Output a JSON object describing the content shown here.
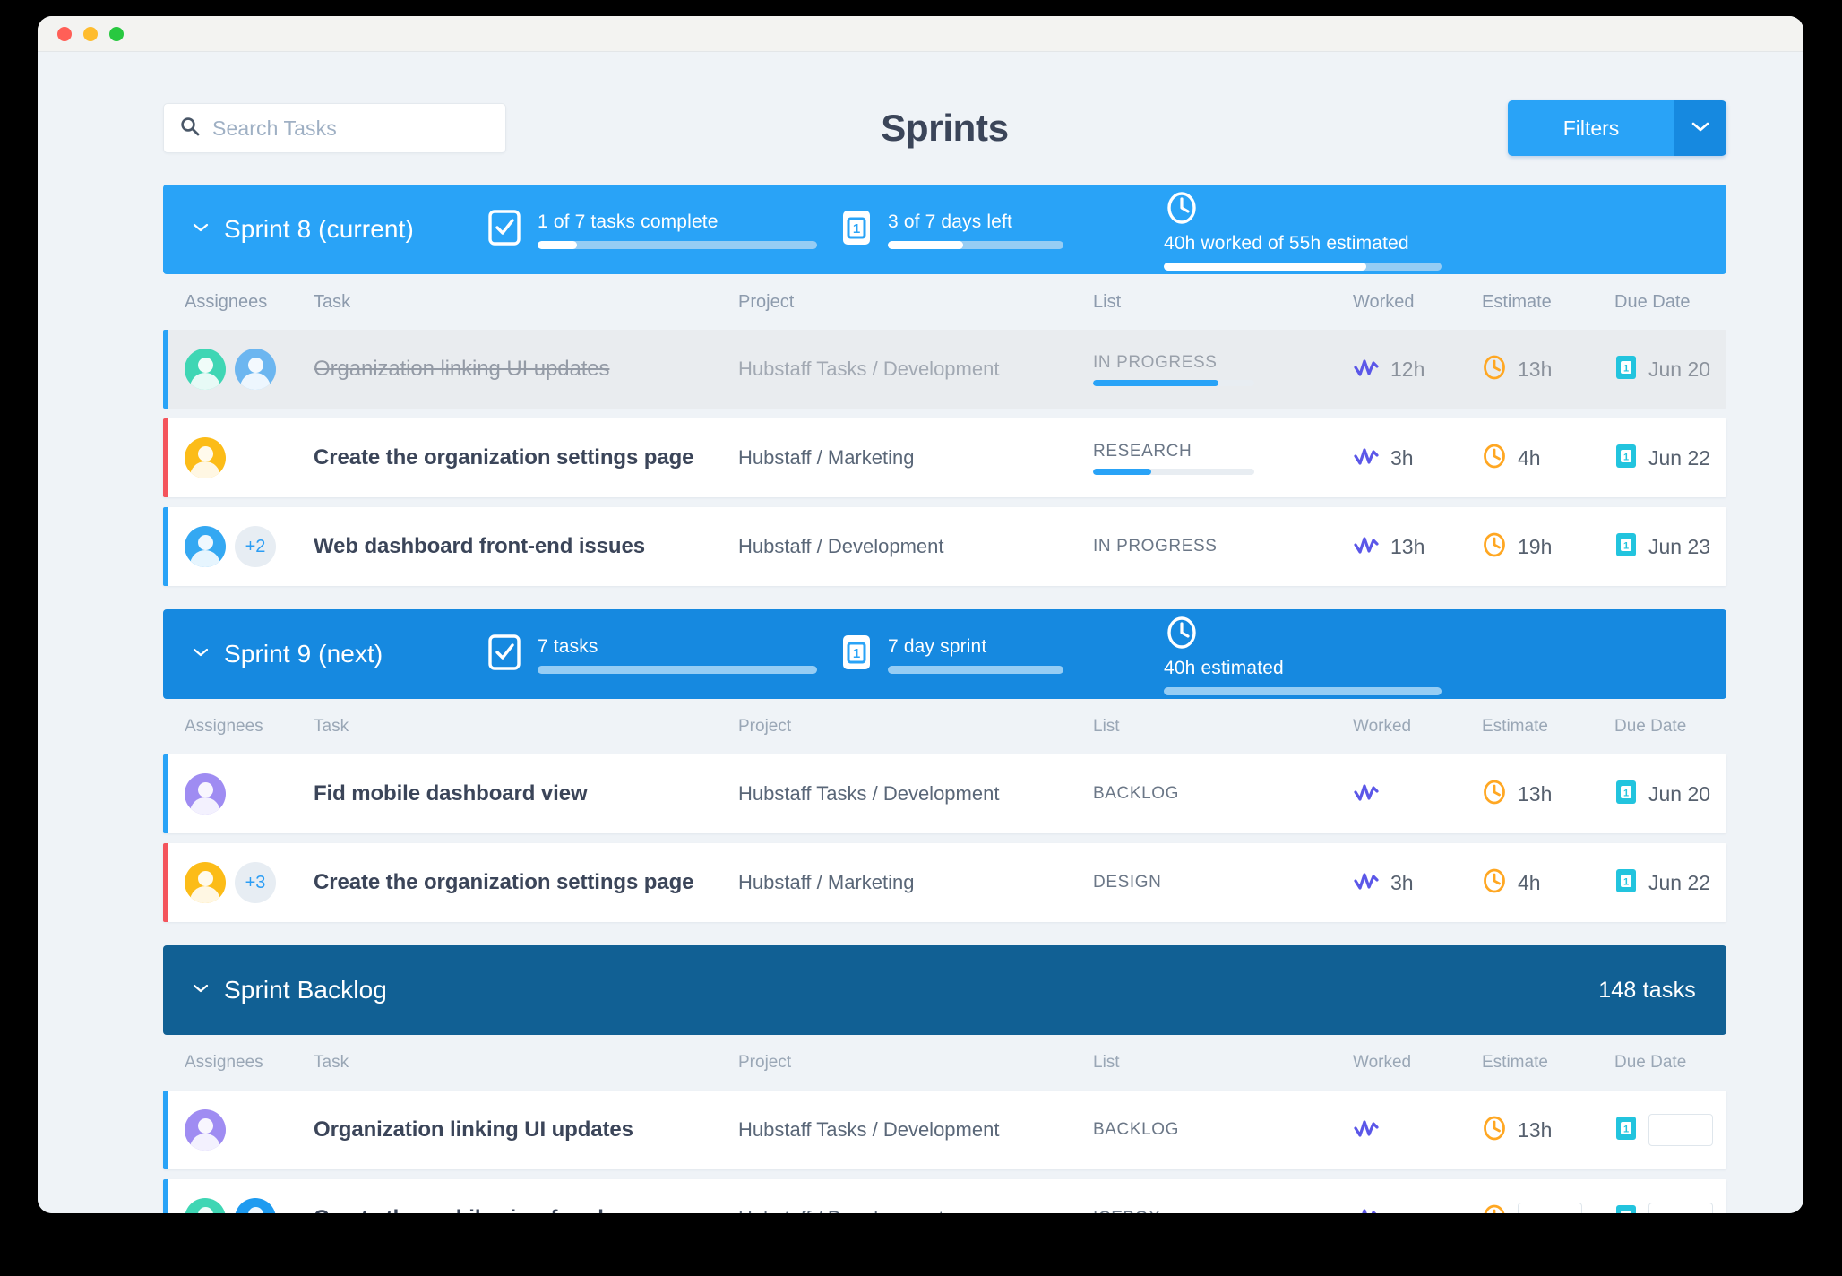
{
  "window": {
    "traffic_lights": [
      "close",
      "minimize",
      "maximize"
    ]
  },
  "header": {
    "title": "Sprints",
    "search": {
      "placeholder": "Search Tasks",
      "value": "",
      "icon": "search-icon"
    },
    "filters": {
      "label": "Filters",
      "caret_icon": "chevron-down-icon"
    }
  },
  "colors": {
    "accent_blue": "#29a3f7",
    "accent_blue_dark": "#1689e0",
    "backlog_blue": "#116094",
    "accent_red": "#f4545c",
    "worked_purple": "#5b57e8",
    "estimate_orange": "#ffa722",
    "due_cyan": "#22c4de",
    "text_dark": "#3b4559",
    "text_muted": "#8d9bad"
  },
  "columns": [
    "Assignees",
    "Task",
    "Project",
    "List",
    "Worked",
    "Estimate",
    "Due Date"
  ],
  "sections": [
    {
      "id": "sprint-8",
      "title": "Sprint 8 (current)",
      "style": "current",
      "collapse_icon": "chevron-down-icon",
      "stats": [
        {
          "icon": "checkbox-icon",
          "text": "1 of 7 tasks complete",
          "progress_pct": 14
        },
        {
          "icon": "calendar-icon",
          "text": "3 of 7 days left",
          "progress_pct": 43
        },
        {
          "icon": "clock-icon",
          "text": "40h worked of 55h estimated",
          "progress_pct": 73
        }
      ],
      "rows": [
        {
          "avatars": [
            "teal",
            "blue"
          ],
          "extra": "",
          "task": "Organization linking UI updates",
          "project": "Hubstaff Tasks / Development",
          "list": "IN PROGRESS",
          "list_progress_pct": 78,
          "worked": "12h",
          "estimate": "13h",
          "due": "Jun 20",
          "accent": "blue",
          "done": true
        },
        {
          "avatars": [
            "gold"
          ],
          "extra": "",
          "task": "Create the organization settings page",
          "project": "Hubstaff / Marketing",
          "list": "RESEARCH",
          "list_progress_pct": 36,
          "worked": "3h",
          "estimate": "4h",
          "due": "Jun 22",
          "accent": "red",
          "done": false
        },
        {
          "avatars": [
            "sky"
          ],
          "extra": "+2",
          "task": "Web dashboard front-end issues",
          "project": "Hubstaff / Development",
          "list": "IN PROGRESS",
          "list_progress_pct": null,
          "worked": "13h",
          "estimate": "19h",
          "due": "Jun 23",
          "accent": "blue",
          "done": false
        }
      ]
    },
    {
      "id": "sprint-9",
      "title": "Sprint 9 (next)",
      "style": "next",
      "collapse_icon": "chevron-down-icon",
      "stats": [
        {
          "icon": "checkbox-icon",
          "text": "7 tasks",
          "progress_pct": 0
        },
        {
          "icon": "calendar-icon",
          "text": "7 day sprint",
          "progress_pct": 0
        },
        {
          "icon": "clock-icon",
          "text": "40h estimated",
          "progress_pct": 0
        }
      ],
      "rows": [
        {
          "avatars": [
            "violet"
          ],
          "extra": "",
          "task": "Fid mobile dashboard view",
          "project": "Hubstaff Tasks / Development",
          "list": "BACKLOG",
          "list_progress_pct": null,
          "worked": "",
          "estimate": "13h",
          "due": "Jun 20",
          "accent": "blue",
          "done": false
        },
        {
          "avatars": [
            "gold"
          ],
          "extra": "+3",
          "task": "Create the organization settings page",
          "project": "Hubstaff / Marketing",
          "list": "DESIGN",
          "list_progress_pct": null,
          "worked": "3h",
          "estimate": "4h",
          "due": "Jun 22",
          "accent": "red",
          "done": false
        }
      ]
    },
    {
      "id": "sprint-backlog",
      "title": "Sprint Backlog",
      "style": "backlog",
      "collapse_icon": "chevron-down-icon",
      "count_label": "148 tasks",
      "stats": [],
      "rows": [
        {
          "avatars": [
            "violet"
          ],
          "extra": "",
          "task": "Organization linking UI updates",
          "project": "Hubstaff Tasks / Development",
          "list": "BACKLOG",
          "list_progress_pct": null,
          "worked": "",
          "estimate": "13h",
          "due": "",
          "accent": "blue",
          "done": false
        },
        {
          "avatars": [
            "teal",
            "azure"
          ],
          "extra": "",
          "task": "Create the mobile view for phones",
          "project": "Hubstaff / Development",
          "list": "ICEBOX",
          "list_progress_pct": null,
          "worked": "",
          "estimate": "",
          "due": "",
          "accent": "blue",
          "done": false
        }
      ]
    }
  ]
}
